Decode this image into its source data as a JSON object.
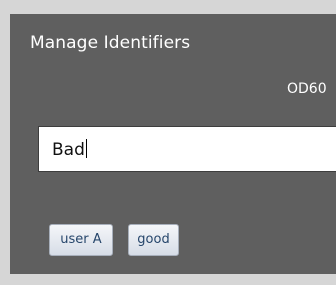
{
  "dialog": {
    "title": "Manage Identifiers",
    "code_label": "OD60",
    "input_value": "Bad",
    "buttons": [
      "user A",
      "good"
    ]
  }
}
